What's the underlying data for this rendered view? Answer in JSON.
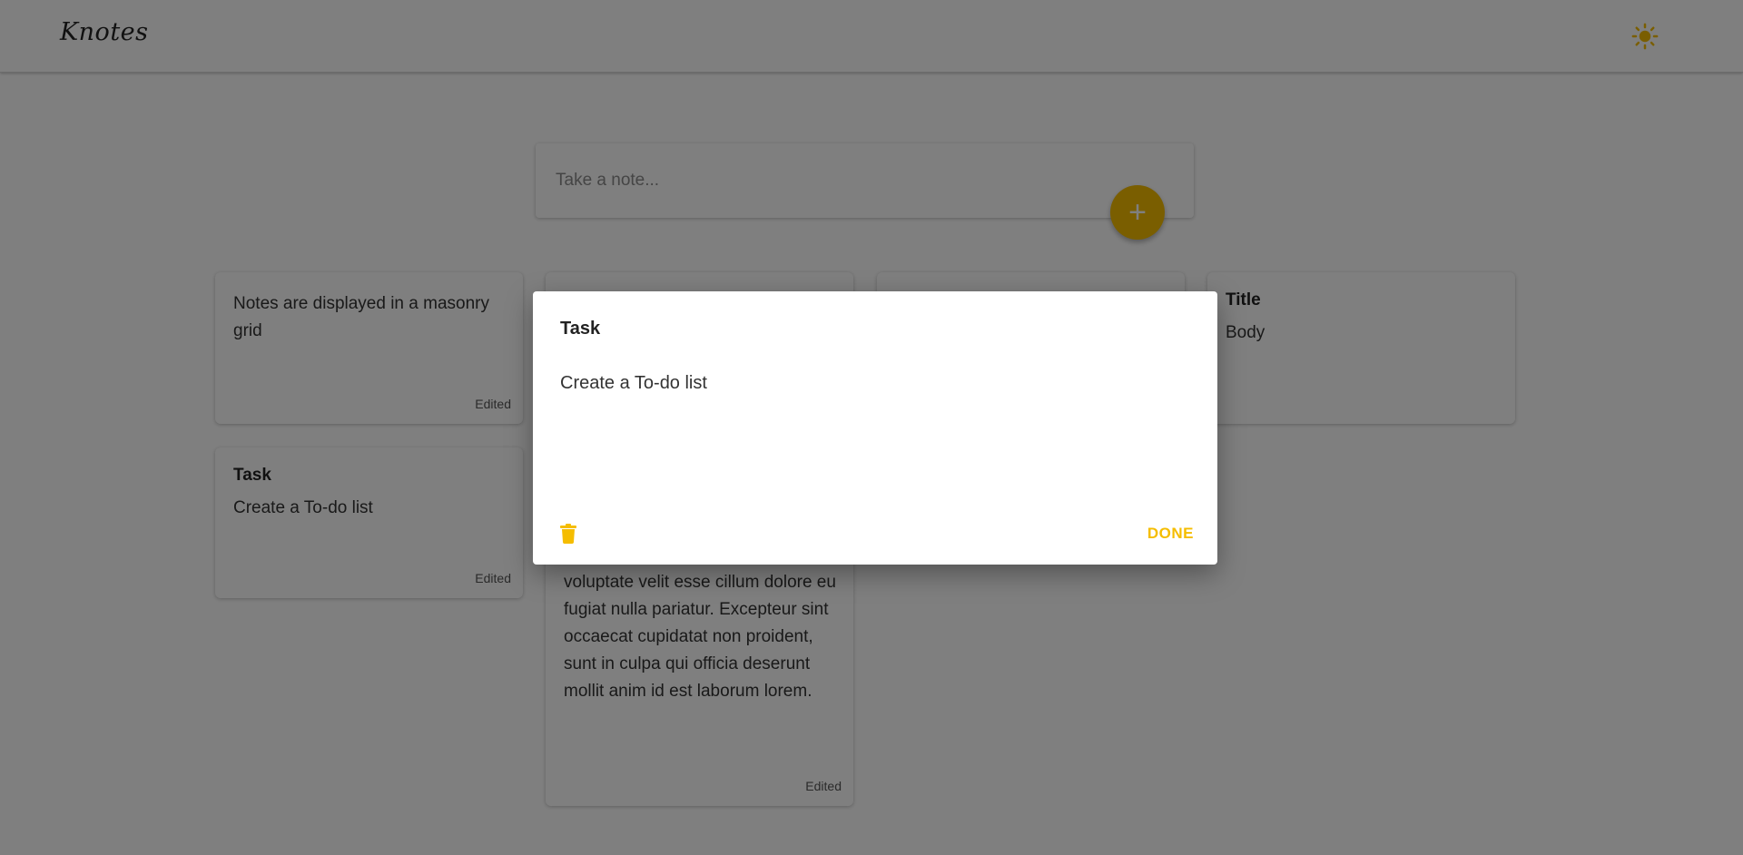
{
  "header": {
    "logo": "Knotes",
    "theme_icon": "sun-icon"
  },
  "composer": {
    "placeholder": "Take a note...",
    "add_icon": "plus-icon",
    "add_label": "+"
  },
  "notes": [
    {
      "title": "",
      "body": "Notes are displayed in a masonry grid",
      "edited": "Edited"
    },
    {
      "title": "Task",
      "body": "Create a To-do list",
      "edited": "Edited"
    },
    {
      "title": "",
      "body": "voluptate velit esse cillum dolore eu fugiat nulla pariatur. Excepteur sint occaecat cupidatat non proident, sunt in culpa qui officia deserunt mollit anim id est laborum lorem.",
      "edited": "Edited"
    },
    {
      "title": "Title",
      "body": "Body",
      "edited": ""
    }
  ],
  "dialog": {
    "title": "Task",
    "body": "Create a To-do list",
    "delete_icon": "trash-icon",
    "done_label": "DONE"
  },
  "colors": {
    "accent": "#f5bd00",
    "overlay": "rgba(0,0,0,0.5)"
  }
}
